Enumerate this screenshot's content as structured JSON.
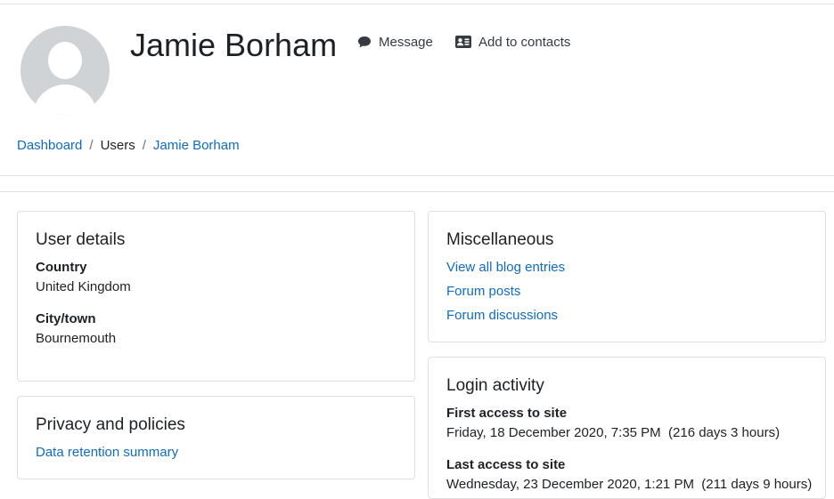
{
  "profile": {
    "name": "Jamie Borham",
    "message_label": "Message",
    "add_contacts_label": "Add to contacts"
  },
  "icons": {
    "message": "comment-icon",
    "add_contacts": "address-card-icon",
    "avatar": "default-user-avatar"
  },
  "breadcrumb": {
    "items": [
      "Dashboard",
      "Users",
      "Jamie Borham"
    ]
  },
  "user_details": {
    "title": "User details",
    "country_label": "Country",
    "country_value": "United Kingdom",
    "city_label": "City/town",
    "city_value": "Bournemouth"
  },
  "privacy": {
    "title": "Privacy and policies",
    "link": "Data retention summary"
  },
  "misc": {
    "title": "Miscellaneous",
    "links": [
      "View all blog entries",
      "Forum posts",
      "Forum discussions"
    ]
  },
  "login": {
    "title": "Login activity",
    "first_label": "First access to site",
    "first_value": "Friday, 18 December 2020, 7:35 PM  (216 days 3 hours)",
    "last_label": "Last access to site",
    "last_value": "Wednesday, 23 December 2020, 1:21 PM  (211 days 9 hours)"
  },
  "colors": {
    "link": "#0f6cbf",
    "text": "#1d2125",
    "border": "#dee2e6"
  }
}
